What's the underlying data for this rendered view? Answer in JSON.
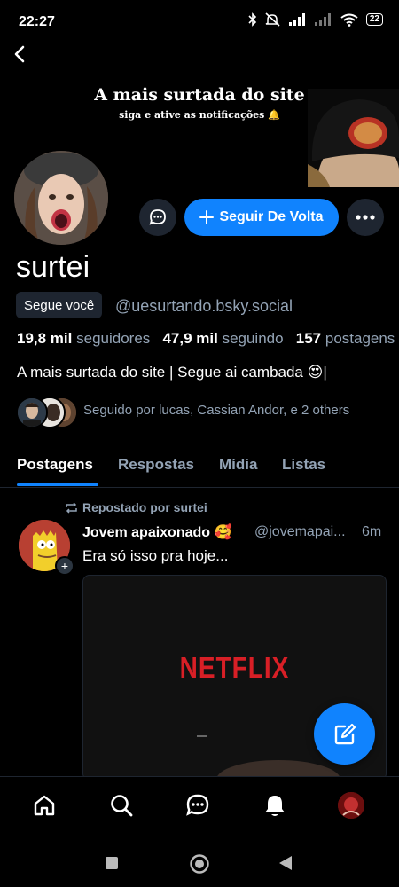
{
  "status_bar": {
    "time": "22:27",
    "battery": "22"
  },
  "banner": {
    "title": "A mais surtada do site",
    "subtitle": "siga e ative as notificações 🔔"
  },
  "profile": {
    "display_name": "surtei",
    "follows_you_label": "Segue você",
    "handle": "@uesurtando.bsky.social",
    "followers_count": "19,8 mil",
    "followers_label": "seguidores",
    "following_count": "47,9 mil",
    "following_label": "seguindo",
    "posts_count": "157",
    "posts_label": "postagens",
    "bio": "A mais surtada do site | Segue ai cambada 😍|",
    "known_followers": "Seguido por lucas, Cassian Andor, e 2 others"
  },
  "actions": {
    "follow_back_label": "Seguir De Volta",
    "accent_color": "#1083fe"
  },
  "tabs": [
    {
      "label": "Postagens",
      "active": true
    },
    {
      "label": "Respostas",
      "active": false
    },
    {
      "label": "Mídia",
      "active": false
    },
    {
      "label": "Listas",
      "active": false
    }
  ],
  "post": {
    "repost_label": "Repostado por surtei",
    "author": "Jovem apaixonado 🥰",
    "handle": "@jovemapai...",
    "time": "6m",
    "text": "Era só isso pra hoje...",
    "media_text": "NETFLIX"
  },
  "bottom_nav": {
    "items": [
      "home-icon",
      "search-icon",
      "chat-icon",
      "bell-icon",
      "profile-avatar"
    ]
  }
}
